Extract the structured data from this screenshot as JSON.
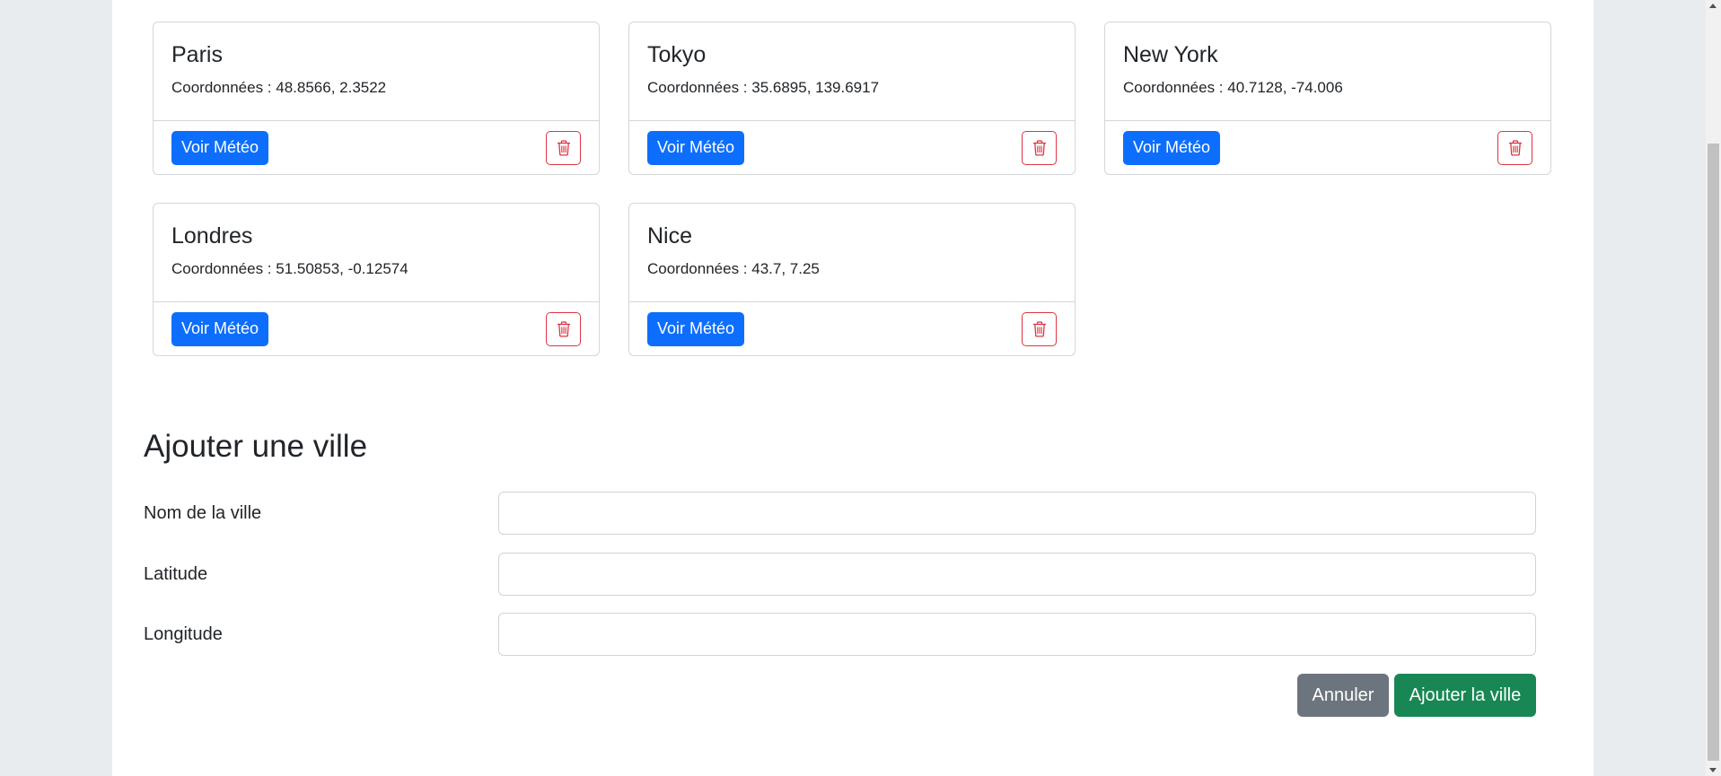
{
  "cities": [
    {
      "name": "Paris",
      "coords_label": "Coordonnées : 48.8566, 2.3522",
      "button_label": "Voir Météo",
      "delete_icon": "trash-icon"
    },
    {
      "name": "Tokyo",
      "coords_label": "Coordonnées : 35.6895, 139.6917",
      "button_label": "Voir Météo",
      "delete_icon": "trash-icon"
    },
    {
      "name": "New York",
      "coords_label": "Coordonnées : 40.7128, -74.006",
      "button_label": "Voir Météo",
      "delete_icon": "trash-icon"
    },
    {
      "name": "Londres",
      "coords_label": "Coordonnées : 51.50853, -0.12574",
      "button_label": "Voir Météo",
      "delete_icon": "trash-icon"
    },
    {
      "name": "Nice",
      "coords_label": "Coordonnées : 43.7, 7.25",
      "button_label": "Voir Météo",
      "delete_icon": "trash-icon"
    }
  ],
  "form": {
    "title": "Ajouter une ville",
    "name_label": "Nom de la ville",
    "name_value": "",
    "latitude_label": "Latitude",
    "latitude_value": "",
    "longitude_label": "Longitude",
    "longitude_value": "",
    "cancel_label": "Annuler",
    "submit_label": "Ajouter la ville"
  },
  "colors": {
    "primary": "#0d6efd",
    "danger": "#dc3545",
    "secondary": "#6c757d",
    "success": "#198754",
    "background": "#e9ecef"
  }
}
